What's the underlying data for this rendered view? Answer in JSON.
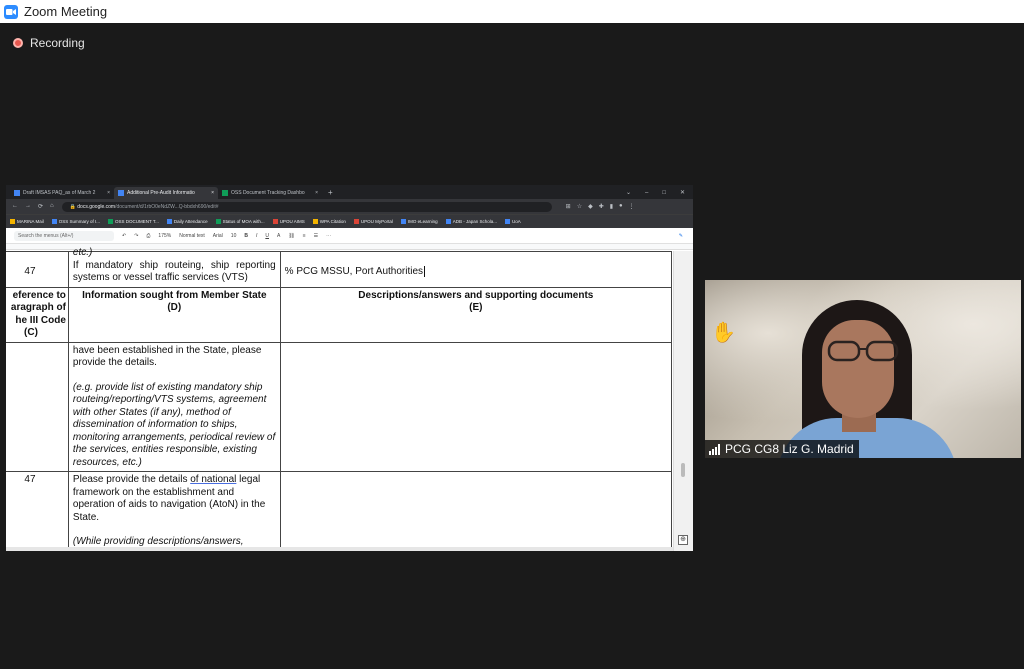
{
  "window": {
    "title": "Zoom Meeting"
  },
  "recording": {
    "label": "Recording"
  },
  "browser": {
    "tabs": [
      {
        "label": "Draft IMSAS PAQ_as of March 2",
        "active": false
      },
      {
        "label": "Additional Pre-Audit Informatio",
        "active": true
      },
      {
        "label": "OSS Document Tracking Dashbo",
        "active": false
      }
    ],
    "url_domain": "docs.google.com",
    "url_path": "/document/d/1rbO0eNdZW...Q-bbdxh690/edit#",
    "bookmarks": [
      "MARINA Mail",
      "OSS Summary of I...",
      "OSS DOCUMENT T...",
      "Daily Attendance",
      "Status of MOA with...",
      "UPOU AIMS",
      "WPA Citation",
      "UPOU MyPortal",
      "IMO eLearning",
      "ADB - Japan Schola...",
      "UoA"
    ],
    "toolbar": {
      "menu_search_placeholder": "Search the menus (Alt+/)",
      "zoom": "175%",
      "style": "Normal text",
      "font": "Arial",
      "font_size": "10"
    }
  },
  "document": {
    "prev_row": {
      "tail_text": "etc.)",
      "number": "47",
      "question": "If mandatory ship routeing, ship reporting systems or vessel traffic services (VTS)",
      "answer": "% PCG MSSU, Port Authorities"
    },
    "header": {
      "col_c_line1": "eference to",
      "col_c_line2": "aragraph of",
      "col_c_line3": "he III Code",
      "col_c_line4": "(C)",
      "col_d_line1": "Information sought from Member State",
      "col_d_line2": "(D)",
      "col_e_line1": "Descriptions/answers and supporting documents",
      "col_e_line2": "(E)"
    },
    "row_continued": {
      "text": "have been established in the State, please provide the details.",
      "italic": "(e.g. provide list of existing mandatory ship routeing/reporting/VTS systems, agreement with other States (if any), method of dissemination of information to ships, monitoring arrangements, periodical review of the services, entities responsible, existing resources, etc.)"
    },
    "row_next": {
      "number": "47",
      "text_before": "Please provide the details ",
      "text_underlined": "of national",
      "text_after": " legal framework on the establishment and operation of aids to navigation (AtoN) in the State.",
      "italic": "(While providing descriptions/answers,"
    }
  },
  "participant": {
    "name": "PCG CG8 Liz G. Madrid",
    "hand_raised": true
  }
}
